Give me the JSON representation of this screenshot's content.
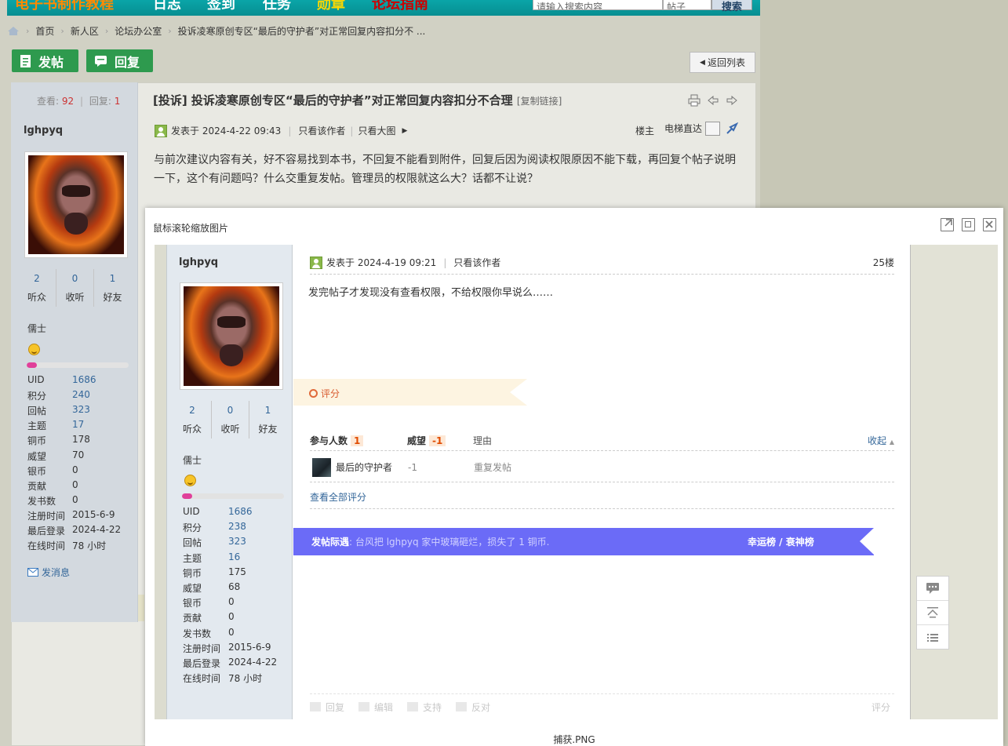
{
  "nav": {
    "items": [
      {
        "label": "电子书制作教程",
        "color": "#ff8a00"
      },
      {
        "label": "日志",
        "color": "#ffffff"
      },
      {
        "label": "签到",
        "color": "#ffffff"
      },
      {
        "label": "任务",
        "color": "#ffffff"
      },
      {
        "label": "勋章",
        "color": "#ffd800"
      },
      {
        "label": "论坛指南",
        "color": "#cc0000"
      }
    ],
    "search_placeholder": "请输入搜索内容",
    "search_type": "帖子",
    "search_button": "搜索"
  },
  "breadcrumb": [
    "首页",
    "新人区",
    "论坛办公室",
    "投诉凌寒原创专区“最后的守护者”对正常回复内容扣分不 ..."
  ],
  "toolbar": {
    "new_post": "发帖",
    "reply": "回复",
    "back": "返回列表"
  },
  "bg_post": {
    "views_label": "查看:",
    "views": "92",
    "replies_label": "回复:",
    "replies": "1",
    "author": "lghpyq",
    "stats": [
      {
        "value": "2",
        "label": "听众"
      },
      {
        "value": "0",
        "label": "收听"
      },
      {
        "value": "1",
        "label": "好友"
      }
    ],
    "rank": "儒士",
    "rank_progress": 0.1,
    "profile": [
      {
        "label": "UID",
        "value": "1686",
        "link": true
      },
      {
        "label": "积分",
        "value": "240",
        "link": true
      },
      {
        "label": "回帖",
        "value": "323",
        "link": true
      },
      {
        "label": "主题",
        "value": "17",
        "link": true
      },
      {
        "label": "铜币",
        "value": "178",
        "link": false
      },
      {
        "label": "威望",
        "value": "70",
        "link": false
      },
      {
        "label": "银币",
        "value": "0",
        "link": false
      },
      {
        "label": "贡献",
        "value": "0",
        "link": false
      },
      {
        "label": "发书数",
        "value": "0",
        "link": false
      },
      {
        "label": "注册时间",
        "value": "2015-6-9",
        "link": false
      },
      {
        "label": "最后登录",
        "value": "2024-4-22",
        "link": false
      },
      {
        "label": "在线时间",
        "value": "78 小时",
        "link": false
      }
    ],
    "send_message": "发消息",
    "title": "[投诉] 投诉凌寒原创专区“最后的守护者”对正常回复内容扣分不合理",
    "copy_link": "[复制链接]",
    "posted": "发表于 2024-4-22 09:43",
    "only_author": "只看该作者",
    "big_image": "只看大图",
    "floor": "楼主",
    "elevator": "电梯直达",
    "body": "与前次建议内容有关，好不容易找到本书，不回复不能看到附件，回复后因为阅读权限原因不能下载，再回复个帖子说明一下，这个有问题吗？什么交重复发帖。管理员的权限就这么大？话都不让说？"
  },
  "modal": {
    "title": "鼠标滚轮缩放图片",
    "caption": "捕获.PNG"
  },
  "img_post": {
    "author": "lghpyq",
    "stats": [
      {
        "value": "2",
        "label": "听众"
      },
      {
        "value": "0",
        "label": "收听"
      },
      {
        "value": "1",
        "label": "好友"
      }
    ],
    "rank": "儒士",
    "rank_progress": 0.1,
    "profile": [
      {
        "label": "UID",
        "value": "1686",
        "link": true
      },
      {
        "label": "积分",
        "value": "238",
        "link": true
      },
      {
        "label": "回帖",
        "value": "323",
        "link": true
      },
      {
        "label": "主题",
        "value": "16",
        "link": true
      },
      {
        "label": "铜币",
        "value": "175",
        "link": false
      },
      {
        "label": "威望",
        "value": "68",
        "link": false
      },
      {
        "label": "银币",
        "value": "0",
        "link": false
      },
      {
        "label": "贡献",
        "value": "0",
        "link": false
      },
      {
        "label": "发书数",
        "value": "0",
        "link": false
      },
      {
        "label": "注册时间",
        "value": "2015-6-9",
        "link": false
      },
      {
        "label": "最后登录",
        "value": "2024-4-22",
        "link": false
      },
      {
        "label": "在线时间",
        "value": "78 小时",
        "link": false
      }
    ],
    "posted": "发表于 2024-4-19 09:21",
    "only_author": "只看该作者",
    "floor": "25楼",
    "body": "发完帖子才发现没有查看权限，不给权限你早说么……",
    "rate_label": "评分",
    "rate_participants_label": "参与人数",
    "rate_participants": "1",
    "rate_prestige_label": "威望",
    "rate_prestige": "-1",
    "rate_reason_label": "理由",
    "rate_collapse": "收起",
    "rater_name": "最后的守护者",
    "rater_score": "-1",
    "rater_reason": "重复发帖",
    "view_all": "查看全部评分",
    "announce_label": "发帖际遇",
    "announce_text": ": 台风把 lghpyq 家中玻璃砸烂，损失了 1 铜币.",
    "announce_right": "幸运榜 / 衰神榜",
    "actions": [
      "回复",
      "编辑",
      "支持",
      "反对"
    ],
    "rate_action": "评分"
  },
  "colors": {
    "nav_bg": "#0aa5a8",
    "green_button": "#2e9a4e",
    "announce_bg": "#6b6bf7",
    "link_blue": "#336699"
  }
}
